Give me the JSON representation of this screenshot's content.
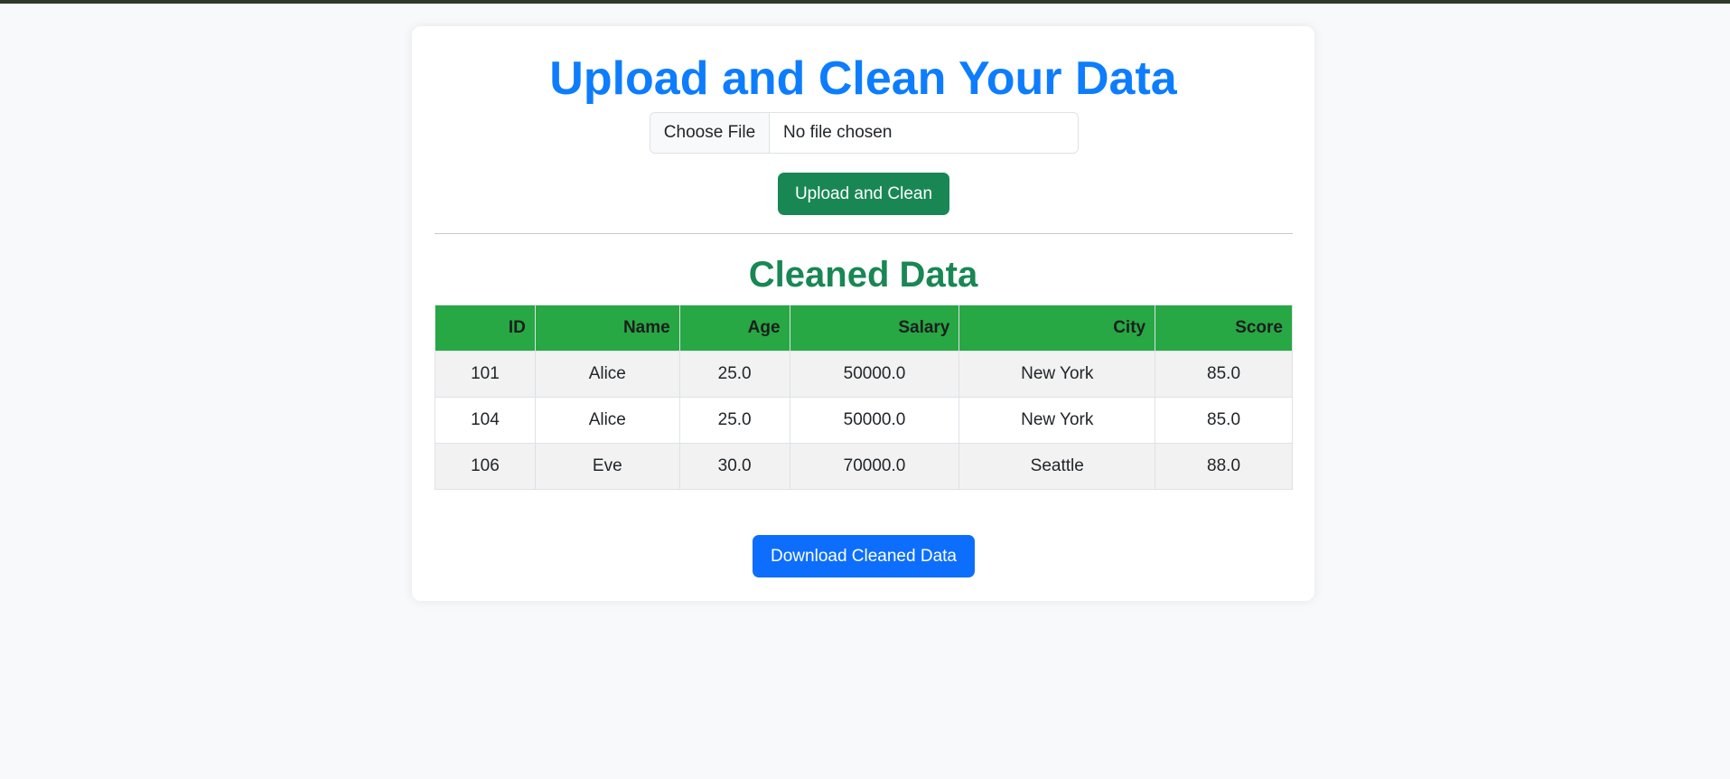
{
  "page": {
    "title": "Upload and Clean Your Data"
  },
  "upload": {
    "choose_file_label": "Choose File",
    "file_status": "No file chosen",
    "submit_label": "Upload and Clean"
  },
  "results": {
    "title": "Cleaned Data",
    "columns": [
      "ID",
      "Name",
      "Age",
      "Salary",
      "City",
      "Score"
    ],
    "rows": [
      [
        "101",
        "Alice",
        "25.0",
        "50000.0",
        "New York",
        "85.0"
      ],
      [
        "104",
        "Alice",
        "25.0",
        "50000.0",
        "New York",
        "85.0"
      ],
      [
        "106",
        "Eve",
        "30.0",
        "70000.0",
        "Seattle",
        "88.0"
      ]
    ],
    "download_label": "Download Cleaned Data"
  },
  "colors": {
    "title_blue": "#0d7dfd",
    "success_green": "#198754",
    "header_green": "#28a745",
    "primary_blue": "#0d6efd"
  }
}
